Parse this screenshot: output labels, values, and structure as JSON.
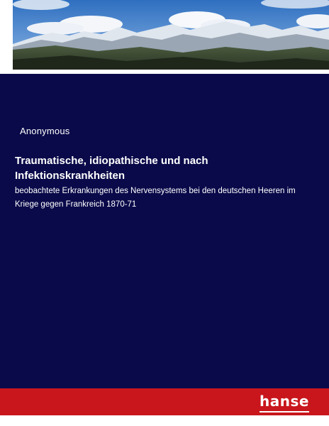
{
  "cover": {
    "author": "Anonymous",
    "title": "Traumatische, idiopathische und nach Infektionskrankheiten",
    "subtitle": "beobachtete Erkrankungen des Nervensystems bei den deutschen Heeren im Kriege gegen Frankreich 1870-71",
    "publisher_logo": "hanse"
  },
  "colors": {
    "panel": "#0a0a4a",
    "footer": "#c8161c",
    "text": "#ffffff"
  }
}
